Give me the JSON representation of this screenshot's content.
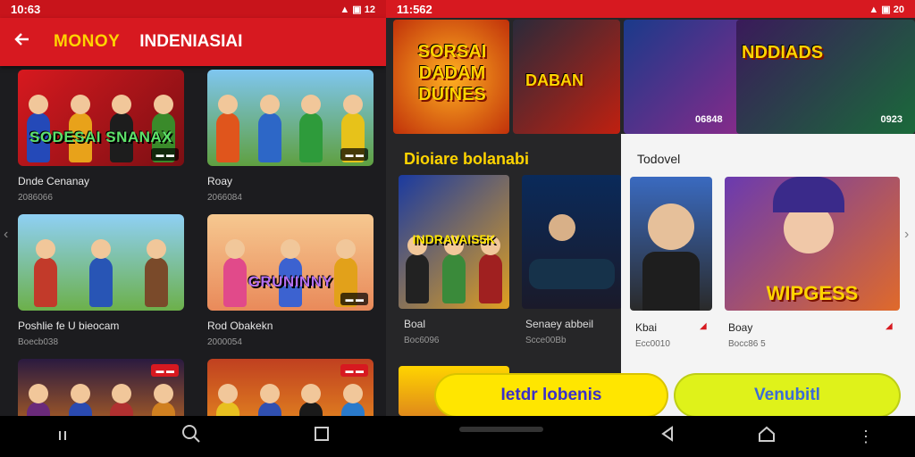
{
  "left_status": {
    "time": "10:63",
    "icons": "▲ ▣ 12"
  },
  "appbar": {
    "back_icon": "arrow-left-icon",
    "brand": "MONOY",
    "title": "INDENIASIAI"
  },
  "cards": [
    {
      "thumb_title": "SODESAI SNANAX",
      "badge": "▬ ▬",
      "title": "Dnde Cenanay",
      "sub": "2086066"
    },
    {
      "thumb_title": "",
      "badge": "▬ ▬",
      "title": "Roay",
      "sub": "2066084"
    },
    {
      "thumb_title": "",
      "badge": "",
      "title": "Poshlie fe U bieocam",
      "sub": "Boecb038"
    },
    {
      "thumb_title": "GRUNINNY",
      "badge": "▬ ▬",
      "title": "Rod Obakekn",
      "sub": "2000054"
    },
    {
      "thumb_title": "",
      "badge": "▬ ▬",
      "title": "",
      "sub": ""
    },
    {
      "thumb_title": "",
      "badge": "▬ ▬",
      "title": "",
      "sub": ""
    }
  ],
  "right_status": {
    "time": "11:562",
    "icons": "▲ ▣ 20"
  },
  "hero": [
    {
      "word": "SORSAI DADAM DUINES",
      "count": ""
    },
    {
      "word": "DABAN",
      "count": ""
    },
    {
      "word": "NDDIADS",
      "count": "06848"
    },
    {
      "word": "",
      "count": "0923"
    }
  ],
  "section": {
    "title": "Dioiare bolanabi"
  },
  "rlist": [
    {
      "thumb_title": "INDRAVAIS5K",
      "title": "Boal",
      "sub": "Boc6096"
    },
    {
      "thumb_title": "",
      "title": "Senaey abbeil",
      "sub": "Scce00Bb"
    }
  ],
  "panel": {
    "title": "Todovel",
    "cards": [
      {
        "title": "Kbai",
        "sub": "Ecc0010"
      },
      {
        "title": "Boay",
        "sub": "Bocc86 5",
        "thumb_title": "WIPGESS"
      }
    ]
  },
  "buttons": {
    "primary": "Ietdr lobenis",
    "secondary": "Venubitl"
  },
  "colors": {
    "accent": "#d71920",
    "yellow": "#ffd400"
  }
}
